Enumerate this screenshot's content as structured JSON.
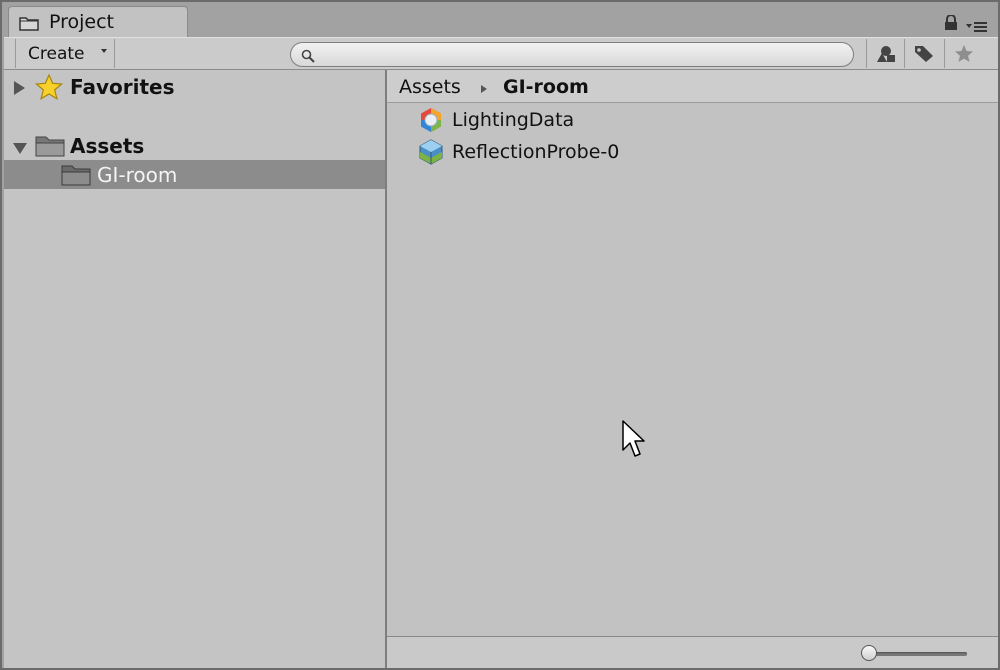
{
  "window": {
    "tab_label": "Project",
    "tab_icon": "folder-icon",
    "lock_icon": "lock-icon",
    "menu_icon": "panel-menu-icon"
  },
  "toolbar": {
    "create_label": "Create",
    "search_placeholder": "",
    "search_value": "",
    "filter_type_icon": "filter-by-type-icon",
    "filter_label_icon": "filter-by-label-icon",
    "favorite_icon": "star-icon"
  },
  "tree": {
    "favorites_label": "Favorites",
    "assets_label": "Assets",
    "child_label": "GI-room"
  },
  "breadcrumb": {
    "root": "Assets",
    "current": "GI-room"
  },
  "items": [
    {
      "label": "LightingData",
      "icon": "lighting-data-icon"
    },
    {
      "label": "ReflectionProbe-0",
      "icon": "reflection-probe-icon"
    }
  ],
  "footer": {
    "zoom_level": 0.0
  },
  "colors": {
    "selection": "#8c8c8c",
    "panel": "#c2c2c2",
    "toolbar": "#cbcbcb"
  }
}
